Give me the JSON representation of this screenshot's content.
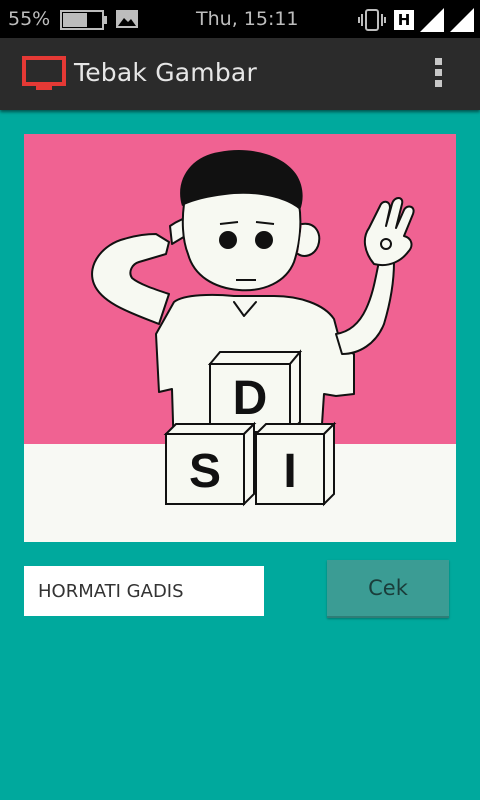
{
  "status_bar": {
    "battery_percent": "55%",
    "time": "Thu, 15:11",
    "network_type": "H",
    "icons": [
      "battery-icon",
      "gallery-notification-icon",
      "vibrate-icon",
      "hspa-icon",
      "signal-icon",
      "signal-icon"
    ]
  },
  "action_bar": {
    "title": "Tebak Gambar",
    "icon": "tv-icon",
    "overflow_icon": "overflow-menu-icon"
  },
  "puzzle": {
    "letters": {
      "top_block": "D",
      "left_block": "S",
      "right_block": "I"
    }
  },
  "answer": {
    "value": "HORMATI GADIS"
  },
  "check_button": {
    "label": "Cek"
  },
  "colors": {
    "background": "#00a99d",
    "action_bar": "#2b2b2b",
    "app_icon": "#e53935",
    "picture_pink": "#f06292",
    "button": "#3b9c94"
  }
}
